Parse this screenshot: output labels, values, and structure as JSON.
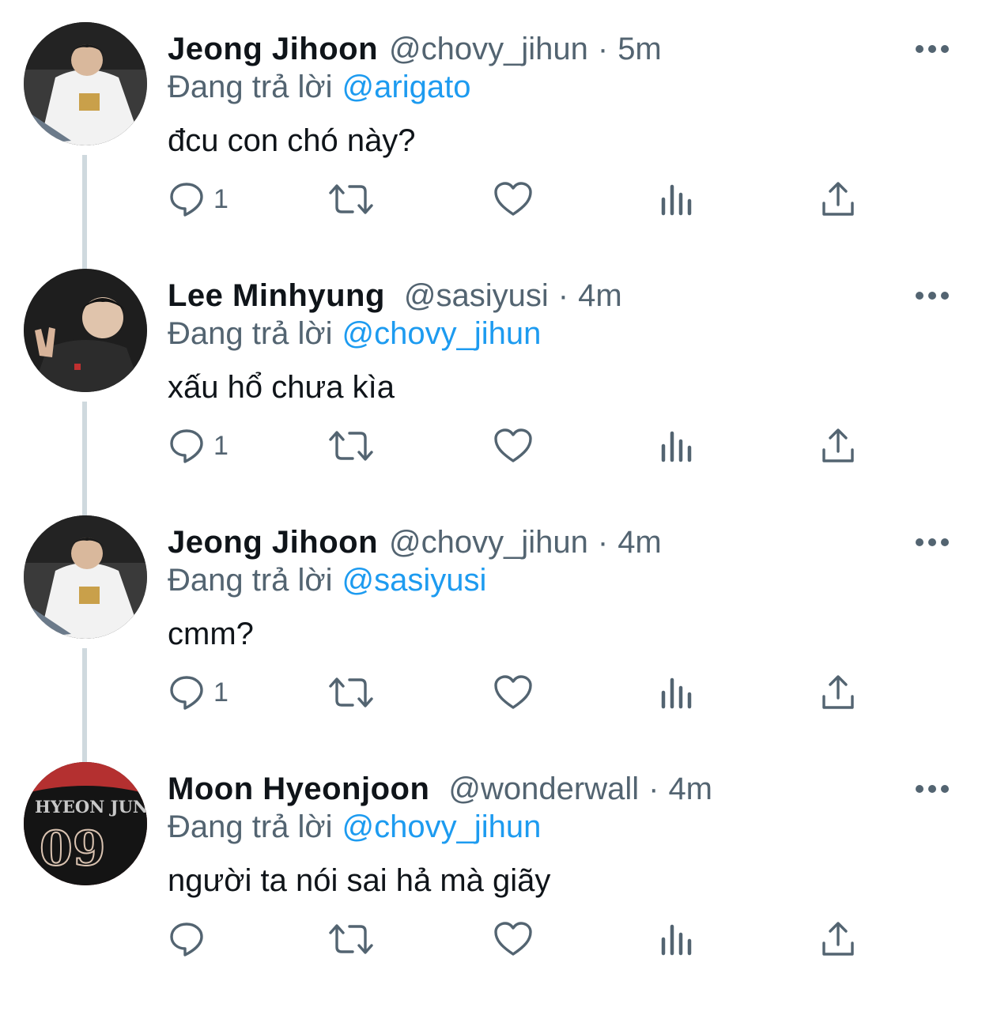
{
  "thread": [
    {
      "name": "Jeong Jihoon",
      "handle": "@chovy_jihun",
      "separator": "·",
      "time": "5m",
      "replying_prefix": "Đang trả lời",
      "replying_to": "@arigato",
      "text": "đcu con chó này?",
      "reply_count": "1",
      "avatar_icon": "profile-photo"
    },
    {
      "name": "Lee Minhyung",
      "handle": "@sasiyusi",
      "separator": "·",
      "time": "4m",
      "replying_prefix": "Đang trả lời",
      "replying_to": "@chovy_jihun",
      "text": "xấu hổ chưa kìa",
      "reply_count": "1",
      "avatar_icon": "profile-photo"
    },
    {
      "name": "Jeong Jihoon",
      "handle": "@chovy_jihun",
      "separator": "·",
      "time": "4m",
      "replying_prefix": "Đang trả lời",
      "replying_to": "@sasiyusi",
      "text": "cmm?",
      "reply_count": "1",
      "avatar_icon": "profile-photo"
    },
    {
      "name": "Moon Hyeonjoon",
      "handle": "@wonderwall",
      "separator": "·",
      "time": "4m",
      "replying_prefix": "Đang trả lời",
      "replying_to": "@chovy_jihun",
      "text": "người ta nói sai hả mà giãy",
      "reply_count": "",
      "avatar_icon": "profile-photo",
      "avatar_jersey_text": "HYEON JUN 09"
    }
  ],
  "colors": {
    "text_primary": "#0f1419",
    "text_secondary": "#536471",
    "link": "#1d9bf0",
    "thread_line": "#cfd9de"
  },
  "icons": [
    "reply-icon",
    "retweet-icon",
    "like-icon",
    "views-icon",
    "share-icon",
    "more-icon"
  ]
}
